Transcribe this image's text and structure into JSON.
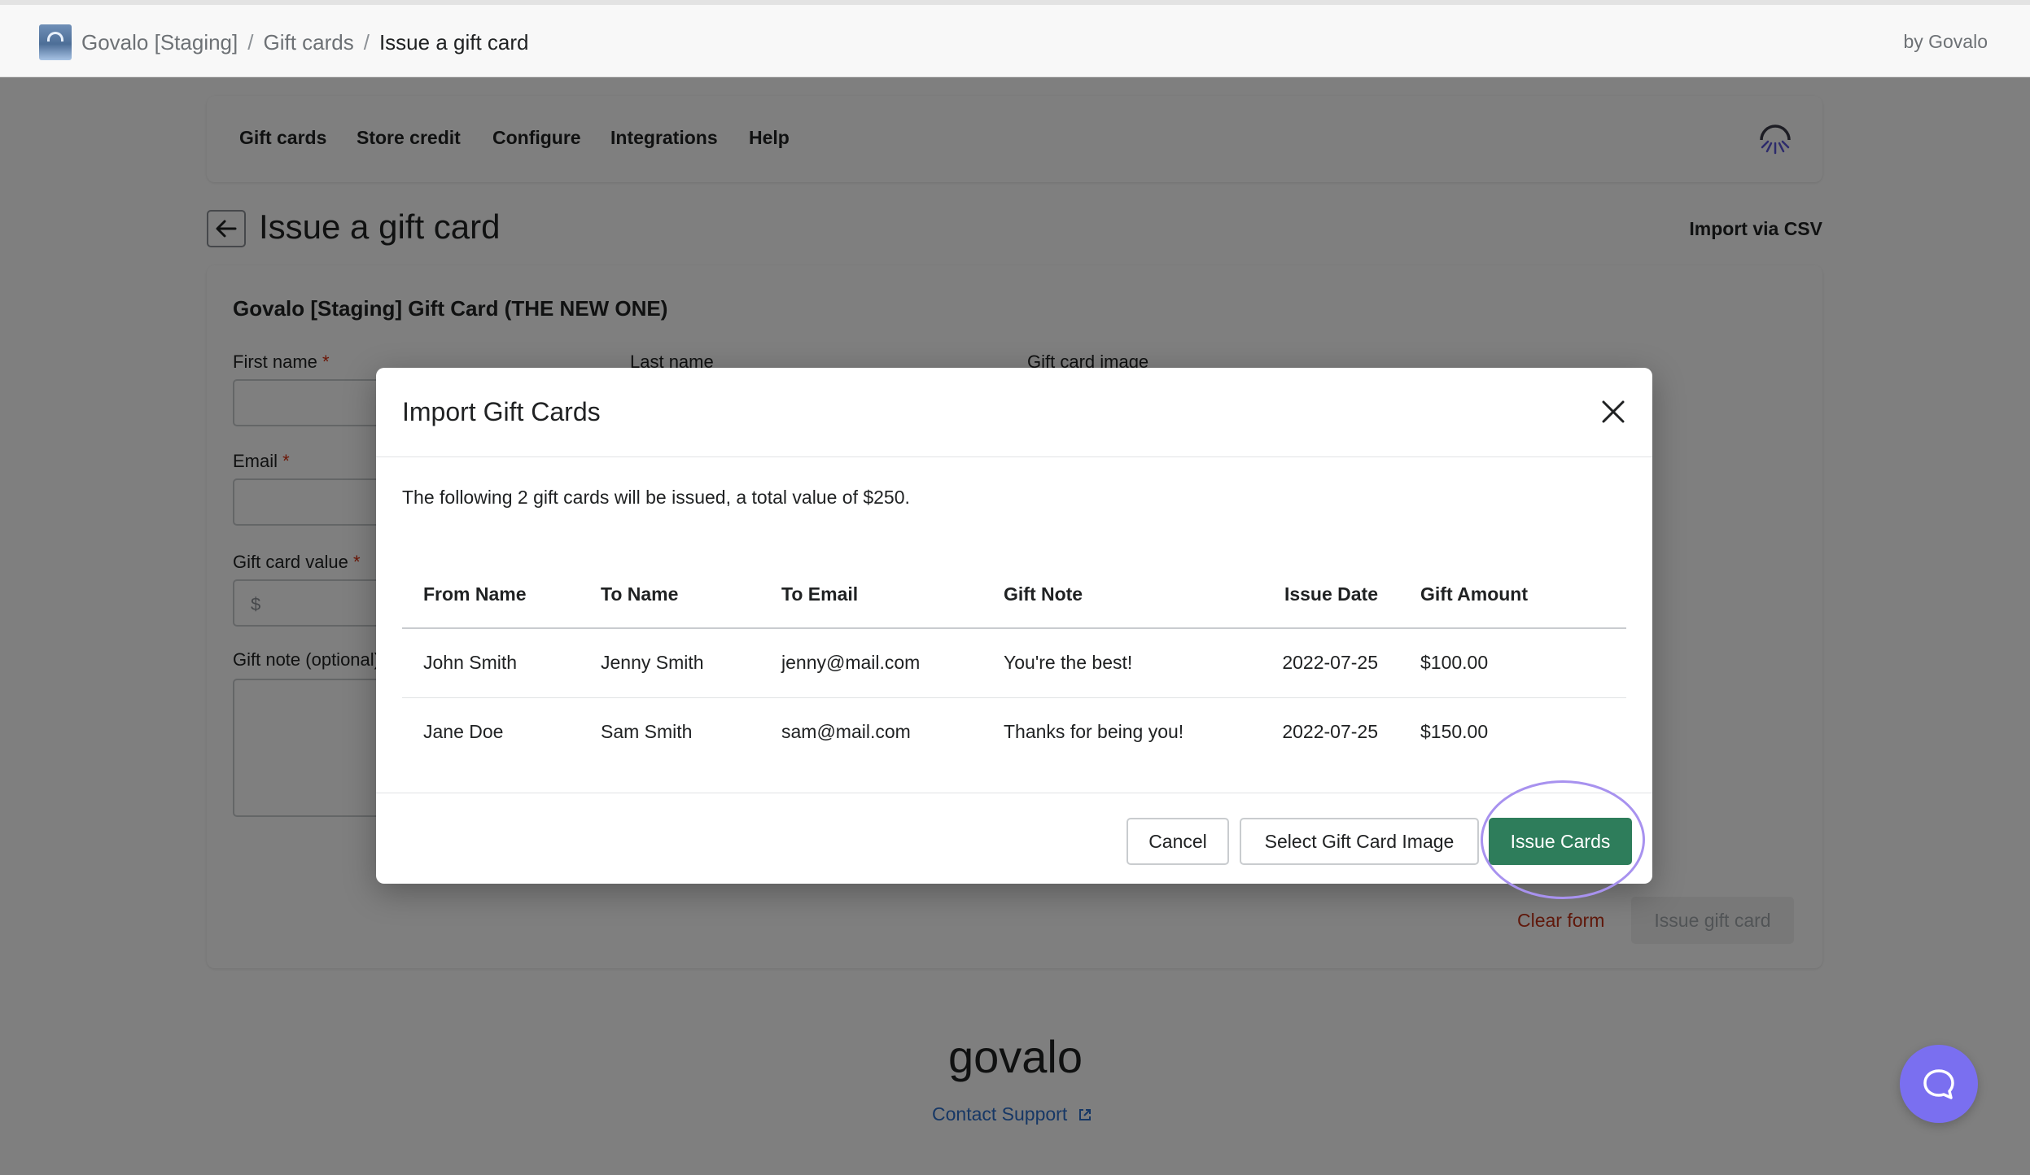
{
  "topbar": {
    "breadcrumb": [
      "Govalo [Staging]",
      "Gift cards",
      "Issue a gift card"
    ],
    "separator": "/",
    "by_label": "by Govalo"
  },
  "nav": {
    "items": [
      "Gift cards",
      "Store credit",
      "Configure",
      "Integrations",
      "Help"
    ]
  },
  "page": {
    "title": "Issue a gift card",
    "import_csv_label": "Import via CSV"
  },
  "form": {
    "card_title": "Govalo [Staging] Gift Card (THE NEW ONE)",
    "first_name_label": "First name",
    "last_name_label": "Last name",
    "gift_card_image_label": "Gift card image",
    "email_label": "Email",
    "gift_card_value_label": "Gift card value",
    "currency_symbol": "$",
    "gift_note_label": "Gift note (optional)",
    "required_mark": "*",
    "clear_form_label": "Clear form",
    "issue_gift_card_label": "Issue gift card"
  },
  "footer": {
    "logo_text": "govalo",
    "contact_support_label": "Contact Support"
  },
  "modal": {
    "title": "Import Gift Cards",
    "summary": "The following 2 gift cards will be issued, a total value of $250.",
    "columns": [
      "From Name",
      "To Name",
      "To Email",
      "Gift Note",
      "Issue Date",
      "Gift Amount"
    ],
    "rows": [
      {
        "from_name": "John Smith",
        "to_name": "Jenny Smith",
        "to_email": "jenny@mail.com",
        "gift_note": "You're the best!",
        "issue_date": "2022-07-25",
        "gift_amount": "$100.00"
      },
      {
        "from_name": "Jane Doe",
        "to_name": "Sam Smith",
        "to_email": "sam@mail.com",
        "gift_note": "Thanks for being you!",
        "issue_date": "2022-07-25",
        "gift_amount": "$150.00"
      }
    ],
    "cancel_label": "Cancel",
    "select_image_label": "Select Gift Card Image",
    "issue_cards_label": "Issue Cards"
  },
  "colors": {
    "primary_button": "#2e7d5b",
    "highlight_ring": "#a892ef",
    "chat_bubble": "#7a6ff0",
    "link": "#2c6ecb",
    "danger": "#c33318"
  },
  "icons": {
    "app": "app-logo-icon",
    "nav_logo": "govalo-logo-icon",
    "back": "arrow-left-icon",
    "close": "close-icon",
    "external": "external-link-icon",
    "chat": "chat-icon"
  }
}
